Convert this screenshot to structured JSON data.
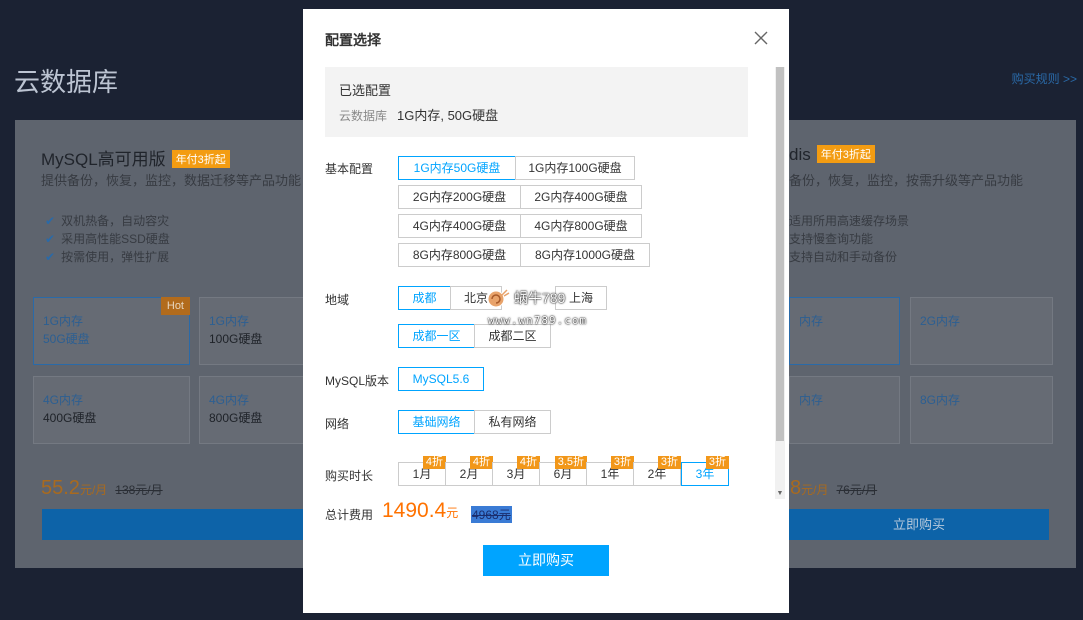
{
  "background": {
    "page_title": "云数据库",
    "purchase_rules": "购买规则 >>",
    "product_left": {
      "name": "MySQL高可用版",
      "badge": "年付3折起",
      "desc": "提供备份，恢复，监控，数据迁移等产品功能",
      "features": [
        "双机热备，自动容灾",
        "采用高性能SSD硬盘",
        "按需使用，弹性扩展"
      ],
      "hot": "Hot",
      "specs": [
        {
          "mem": "1G内存",
          "disk": "50G硬盘"
        },
        {
          "mem": "1G内存",
          "disk": "100G硬盘"
        },
        {
          "mem": "4G内存",
          "disk": "400G硬盘"
        },
        {
          "mem": "4G内存",
          "disk": "800G硬盘"
        }
      ],
      "price": "55.2",
      "unit": "元/月",
      "old_price": "138元/月"
    },
    "product_right": {
      "name": "dis",
      "badge": "年付3折起",
      "desc": "备份，恢复，监控，按需升级等产品功能",
      "features": [
        "适用所用高速缓存场景",
        "支持慢查询功能",
        "支持自动和手动备份"
      ],
      "specs": [
        {
          "mem": "内存"
        },
        {
          "mem": "2G内存"
        },
        {
          "mem": "内存"
        },
        {
          "mem": "8G内存"
        }
      ],
      "price": "8",
      "unit": "元/月",
      "old_price": "76元/月",
      "buy": "立即购买"
    }
  },
  "modal": {
    "title": "配置选择",
    "selected_title": "已选配置",
    "selected_label": "云数据库",
    "selected_value": "1G内存, 50G硬盘",
    "basic_label": "基本配置",
    "basic_options": [
      "1G内存50G硬盘",
      "1G内存100G硬盘",
      "2G内存200G硬盘",
      "2G内存400G硬盘",
      "4G内存400G硬盘",
      "4G内存800G硬盘",
      "8G内存800G硬盘",
      "8G内存1000G硬盘"
    ],
    "region_label": "地域",
    "regions": [
      "成都",
      "北京",
      "上海"
    ],
    "zones": [
      "成都一区",
      "成都二区"
    ],
    "version_label": "MySQL版本",
    "version": "MySQL5.6",
    "network_label": "网络",
    "networks": [
      "基础网络",
      "私有网络"
    ],
    "duration_label": "购买时长",
    "durations": [
      {
        "label": "1月",
        "discount": "4折"
      },
      {
        "label": "2月",
        "discount": "4折"
      },
      {
        "label": "3月",
        "discount": "4折"
      },
      {
        "label": "6月",
        "discount": "3.5折"
      },
      {
        "label": "1年",
        "discount": "3折"
      },
      {
        "label": "2年",
        "discount": "3折"
      },
      {
        "label": "3年",
        "discount": "3折"
      }
    ],
    "total_label": "总计费用",
    "total_price": "1490.4",
    "total_unit": "元",
    "total_old": "4968元",
    "buy_label": "立即购买"
  },
  "watermark": {
    "name": "蜗牛789",
    "site": "www.wn789.com"
  },
  "colors": {
    "accent": "#00a4ff",
    "price": "#ff7200",
    "discount": "#f29719"
  }
}
